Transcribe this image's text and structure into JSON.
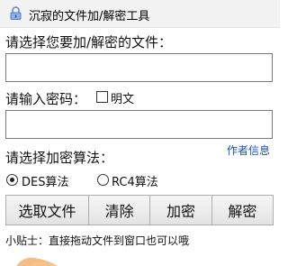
{
  "window": {
    "title": "沉寂的文件加/解密工具"
  },
  "file": {
    "label": "请选择您要加/解密的文件：",
    "value": ""
  },
  "password": {
    "label": "请输入密码：",
    "value": "",
    "show_plain_label": "明文",
    "show_plain_checked": false
  },
  "algorithm": {
    "label": "请选择加密算法：",
    "author_link": "作者信息",
    "options": [
      "DES算法",
      "RC4算法"
    ],
    "selected": "DES算法"
  },
  "buttons": {
    "select_file": "选取文件",
    "clear": "清除",
    "encrypt": "加密",
    "decrypt": "解密"
  },
  "tip": "小贴士：直接拖动文件到窗口也可以哦",
  "colors": {
    "link": "#1a4fbf",
    "decor_orange": "#f2a65a"
  },
  "icons": {
    "app": "padlock-icon"
  }
}
